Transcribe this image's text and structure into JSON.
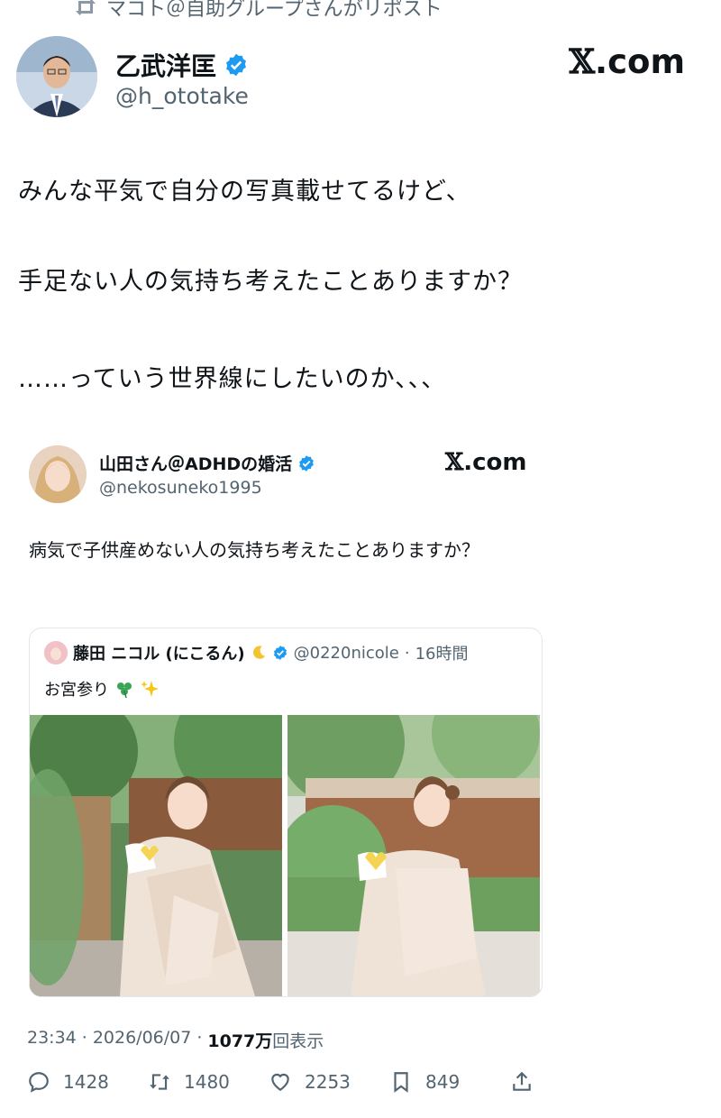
{
  "repost": {
    "text": "マコト＠自助グループさんがリポスト"
  },
  "author": {
    "name": "乙武洋匡",
    "handle": "@h_ototake",
    "brand": "com"
  },
  "tweet": {
    "lines": [
      "みんな平気で自分の写真載せてるけど、",
      "手足ない人の気持ち考えたことありますか？",
      "……っていう世界線にしたいのか、、、"
    ]
  },
  "quoted": {
    "name": "山田さん＠ADHDの婚活",
    "handle": "@nekosuneko1995",
    "brand": "com",
    "text": "病気で子供産めない人の気持ち考えたことありますか？",
    "inner": {
      "name": "藤田 ニコル (にこるん)",
      "handle": "@0220nicole",
      "time": "16時間",
      "text": "お宮参り"
    }
  },
  "meta": {
    "time": "23:34",
    "date": "2026/06/07",
    "views_count": "1077万",
    "views_label": "回表示"
  },
  "actions": {
    "replies": "1428",
    "reposts": "1480",
    "likes": "2253",
    "bookmarks": "849"
  },
  "colors": {
    "verified": "#1d9bf0",
    "muted": "#536471",
    "text": "#0f1419"
  }
}
